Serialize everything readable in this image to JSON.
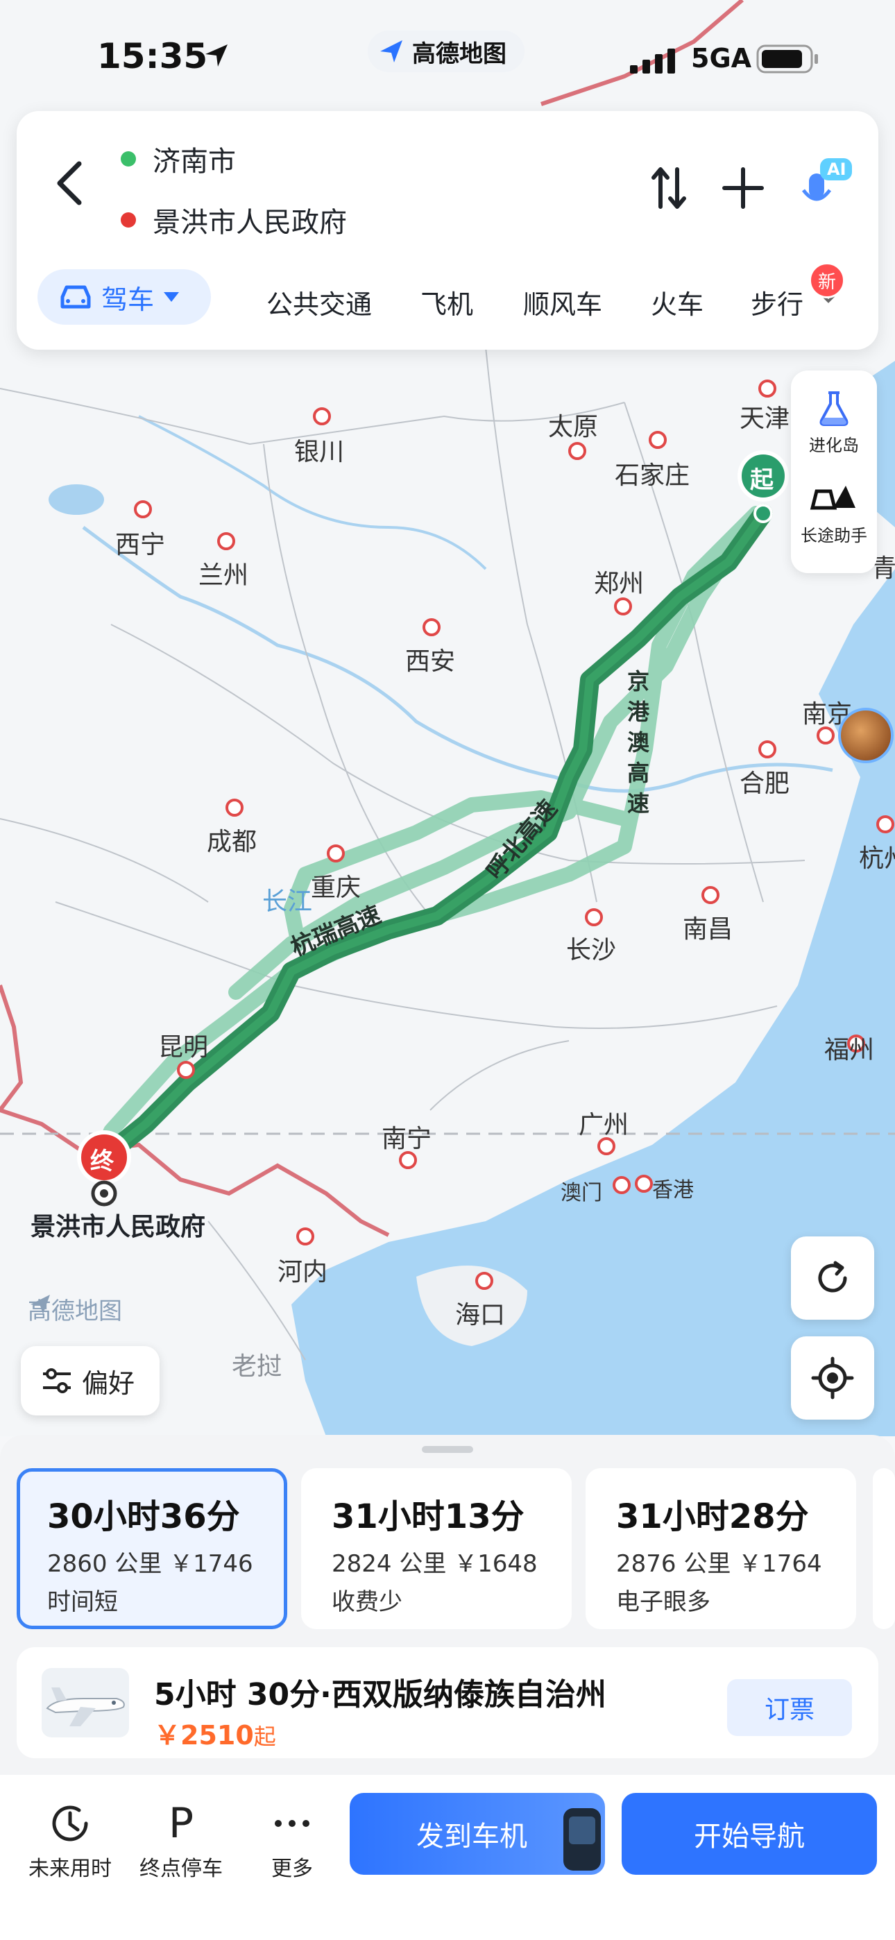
{
  "status_bar": {
    "time": "15:35",
    "app_name": "高德地图",
    "network": "5GA",
    "location_icon": "location-arrow-icon",
    "signal_icon": "signal-bars-icon",
    "battery_icon": "battery-icon"
  },
  "route": {
    "origin": "济南市",
    "destination": "景洪市人民政府",
    "origin_color": "#3bbf6a",
    "destination_color": "#e53935",
    "back_icon": "back-chevron-icon",
    "swap_icon": "swap-icon",
    "add_icon": "plus-icon",
    "ai_icon": "ai-voice-icon",
    "ai_badge": "AI"
  },
  "modes": {
    "active": "驾车",
    "items": [
      "公共交通",
      "飞机",
      "顺风车",
      "火车",
      "步行"
    ],
    "new_badge": "新",
    "accent": "#2a73ff"
  },
  "side_tools": {
    "evolution_island": "进化岛",
    "long_trip_helper": "长途助手"
  },
  "map": {
    "cities": {
      "tianjin": "天津",
      "taiyuan": "太原",
      "shijiazhuang": "石家庄",
      "yinchuan": "银川",
      "xining": "西宁",
      "lanzhou": "兰州",
      "zhengzhou": "郑州",
      "xian": "西安",
      "nanjing": "南京",
      "hefei": "合肥",
      "chengdu": "成都",
      "chongqing": "重庆",
      "hangzhou": "杭州",
      "wuhan_river": "长江",
      "nanchang": "南昌",
      "changsha": "长沙",
      "fuzhou": "福州",
      "kunming": "昆明",
      "nanning": "南宁",
      "guangzhou": "广州",
      "macau": "澳门",
      "hongkong": "香港",
      "hanoi": "河内",
      "haikou": "海口",
      "laocai": "老挝",
      "qing": "青"
    },
    "roads": {
      "hangrui": "杭瑞高速",
      "hubei": "呼北高速",
      "jinggangao": "京港澳高速"
    },
    "start_marker": "起",
    "end_marker": "终",
    "destination_label": "景洪市人民政府",
    "watermark": "高德地图",
    "route_color": "#2e8b57",
    "alt_route_color": "#8fd1b2"
  },
  "controls": {
    "preference": "偏好",
    "refresh_icon": "refresh-icon",
    "locate_icon": "locate-icon",
    "preference_icon": "sliders-icon"
  },
  "route_options": [
    {
      "time": "30小时36分",
      "distance": "2860 公里  ￥1746",
      "tag": "时间短"
    },
    {
      "time": "31小时13分",
      "distance": "2824 公里  ￥1648",
      "tag": "收费少"
    },
    {
      "time": "31小时28分",
      "distance": "2876 公里  ￥1764",
      "tag": "电子眼多"
    }
  ],
  "flight": {
    "title": "5小时 30分·西双版纳傣族自治州",
    "price": "￥2510",
    "price_suffix": "起",
    "book": "订票"
  },
  "bottom": {
    "future_time": "未来用时",
    "parking": "终点停车",
    "more": "更多",
    "send_to_car": "发到车机",
    "start_nav": "开始导航",
    "parking_icon_letter": "P"
  }
}
